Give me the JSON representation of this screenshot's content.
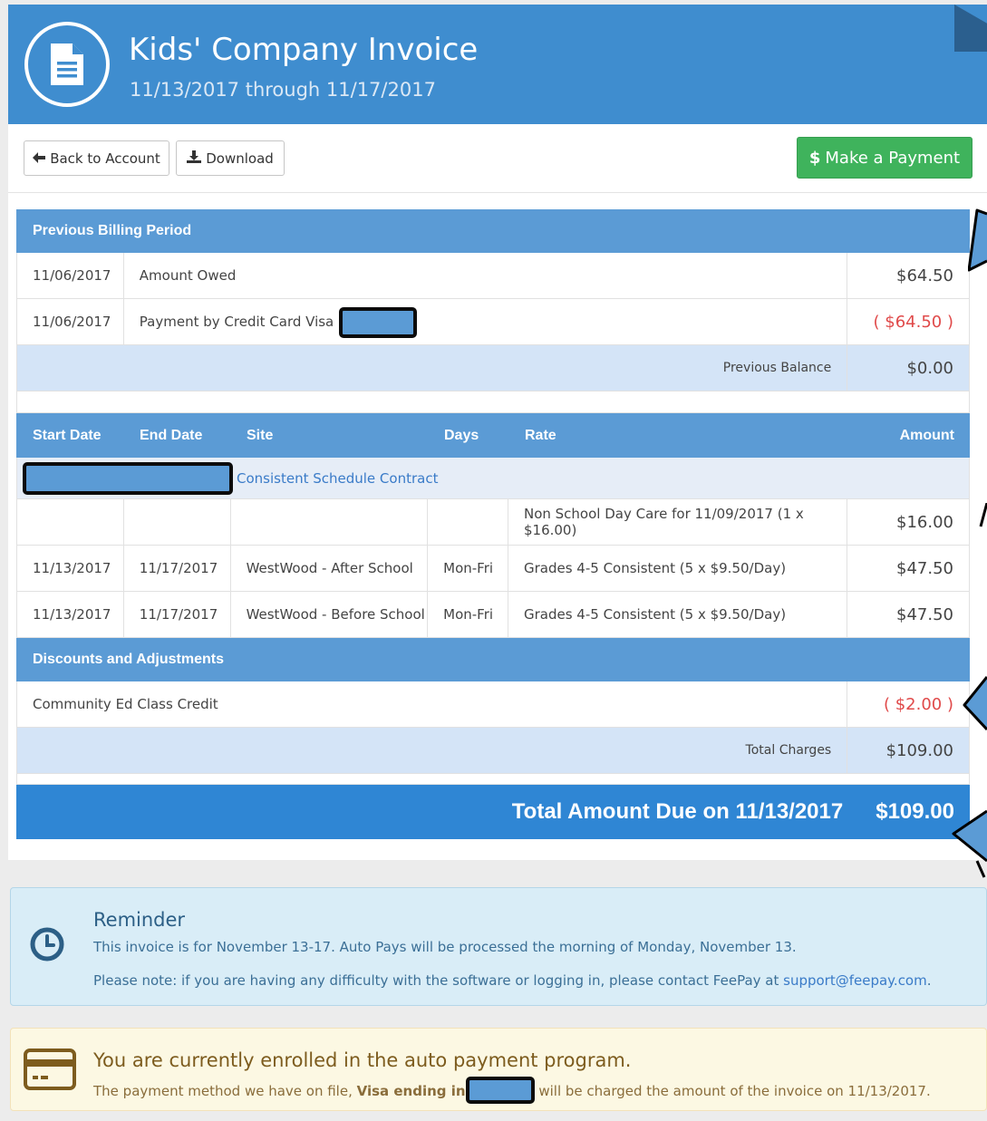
{
  "header": {
    "title": "Kids' Company Invoice",
    "subtitle": "11/13/2017 through 11/17/2017"
  },
  "toolbar": {
    "back_label": "Back to Account",
    "download_label": "Download",
    "pay_label": "Make a Payment",
    "pay_symbol": "$"
  },
  "previous": {
    "heading": "Previous Billing Period",
    "rows": [
      {
        "date": "11/06/2017",
        "desc": "Amount Owed",
        "amount": "$64.50"
      },
      {
        "date": "11/06/2017",
        "desc": "Payment by Credit Card Visa",
        "amount": "( $64.50 )"
      }
    ],
    "balance_label": "Previous Balance",
    "balance_value": "$0.00"
  },
  "charges": {
    "columns": [
      "Start Date",
      "End Date",
      "Site",
      "Days",
      "Rate",
      "Amount"
    ],
    "contract_label": "Consistent Schedule Contract",
    "rows": [
      {
        "start": "",
        "end": "",
        "site": "",
        "days": "",
        "rate": "Non School Day Care for 11/09/2017 (1 x $16.00)",
        "amount": "$16.00"
      },
      {
        "start": "11/13/2017",
        "end": "11/17/2017",
        "site": "WestWood - After School",
        "days": "Mon-Fri",
        "rate": "Grades 4-5 Consistent (5 x $9.50/Day)",
        "amount": "$47.50"
      },
      {
        "start": "11/13/2017",
        "end": "11/17/2017",
        "site": "WestWood - Before School",
        "days": "Mon-Fri",
        "rate": "Grades 4-5 Consistent (5 x $9.50/Day)",
        "amount": "$47.50"
      }
    ]
  },
  "discounts": {
    "heading": "Discounts and Adjustments",
    "rows": [
      {
        "desc": "Community Ed Class Credit",
        "amount": "( $2.00 )"
      }
    ],
    "total_label": "Total Charges",
    "total_value": "$109.00"
  },
  "total_due": {
    "label": "Total Amount Due on 11/13/2017",
    "value": "$109.00"
  },
  "reminder": {
    "title": "Reminder",
    "line1": "This invoice is for November 13-17. Auto Pays will be processed the morning of Monday, November 13.",
    "line2_prefix": "Please note: if you are having any difficulty with the software or logging in, please contact FeePay at ",
    "line2_link": "support@feepay.com",
    "line2_suffix": "."
  },
  "autopay": {
    "title": "You are currently enrolled in the auto payment program.",
    "line_prefix": "The payment method we have on file, ",
    "line_bold": "Visa ending in",
    "line_suffix": " will be charged the amount of the invoice on 11/13/2017."
  },
  "colors": {
    "header_blue": "#3f8dcf",
    "section_blue": "#5b9bd5",
    "total_blue": "#2f86d4",
    "pay_green": "#3fb35c",
    "negative_red": "#e04a4a"
  }
}
